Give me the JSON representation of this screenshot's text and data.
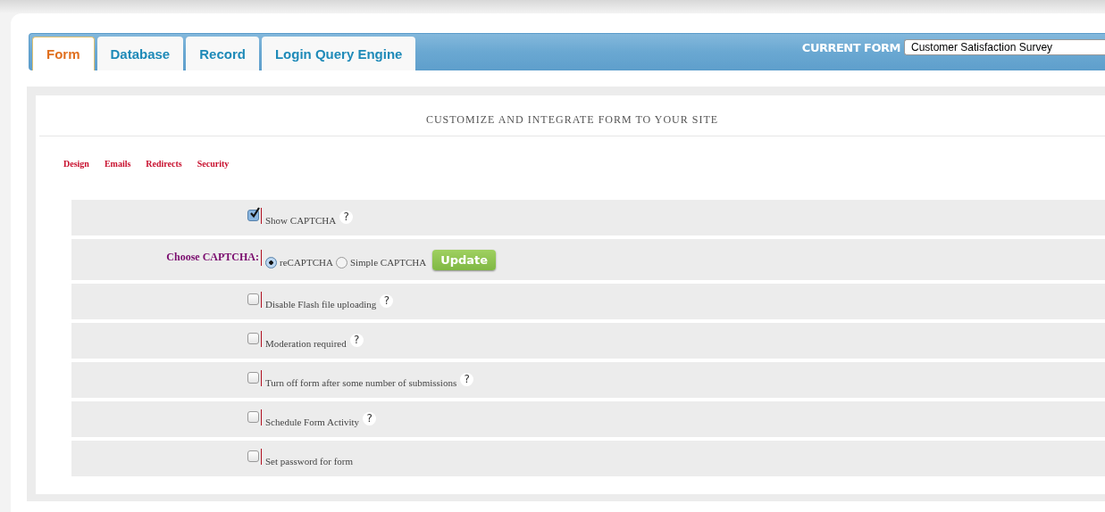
{
  "tabs": [
    {
      "label": "Form",
      "selected": true
    },
    {
      "label": "Database",
      "selected": false
    },
    {
      "label": "Record",
      "selected": false
    },
    {
      "label": "Login Query Engine",
      "selected": false
    }
  ],
  "current_form": {
    "label": "CURRENT FORM",
    "value": "Customer Satisfaction Survey"
  },
  "heading": "CUSTOMIZE AND INTEGRATE FORM TO YOUR SITE",
  "subnav": [
    "Design",
    "Emails",
    "Redirects",
    "Security"
  ],
  "rows": [
    {
      "kind": "checkbox",
      "label": "Show CAPTCHA",
      "checked": true,
      "help": "?"
    },
    {
      "kind": "radio",
      "label": "Choose CAPTCHA:",
      "options": [
        {
          "label": "reCAPTCHA",
          "selected": true
        },
        {
          "label": "Simple CAPTCHA",
          "selected": false
        }
      ],
      "button": "Update"
    },
    {
      "kind": "checkbox",
      "label": "Disable Flash file uploading",
      "checked": false,
      "help": "?"
    },
    {
      "kind": "checkbox",
      "label": "Moderation required",
      "checked": false,
      "help": "?"
    },
    {
      "kind": "checkbox",
      "label": "Turn off form after some number of submissions",
      "checked": false,
      "help": "?"
    },
    {
      "kind": "checkbox",
      "label": "Schedule Form Activity",
      "checked": false,
      "help": "?"
    },
    {
      "kind": "checkbox",
      "label": "Set password for form",
      "checked": false
    }
  ]
}
